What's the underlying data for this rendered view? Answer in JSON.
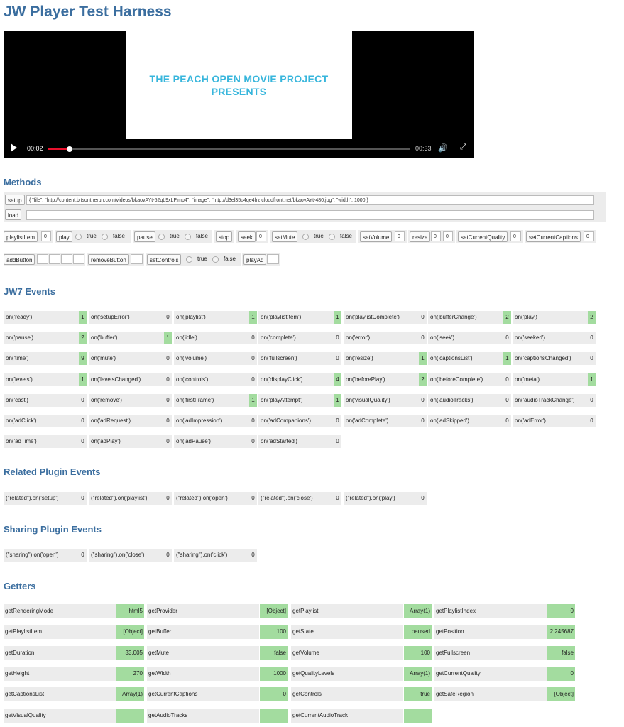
{
  "title": "JW Player Test Harness",
  "player": {
    "poster_line1": "THE PEACH OPEN MOVIE PROJECT",
    "poster_line2": "PRESENTS",
    "elapsed": "00:02",
    "duration": "00:33",
    "progress": 0.06
  },
  "sections": {
    "methods": "Methods",
    "jw7": "JW7 Events",
    "related": "Related Plugin Events",
    "sharing": "Sharing Plugin Events",
    "getters": "Getters"
  },
  "methods": {
    "setup_label": "setup",
    "setup_value": "{    \"file\": \"http://content.bitsontherun.com/videos/bkaovAYt-52qL9xLP.mp4\",    \"image\": \"http://d3el35u4qe4frz.cloudfront.net/bkaovAYt-480.jpg\", \"width\": 1000 }",
    "load_label": "load",
    "playlistItem": "playlistItem",
    "playlistItem_val": "0",
    "play": "play",
    "pause": "pause",
    "stop": "stop",
    "seek": "seek",
    "seek_val": "0",
    "setMute": "setMute",
    "setVolume": "setVolume",
    "setVolume_val": "0",
    "resize": "resize",
    "resize_w": "0",
    "resize_h": "0",
    "setCurrentQuality": "setCurrentQuality",
    "setCurrentQuality_val": "0",
    "setCurrentCaptions": "setCurrentCaptions",
    "setCurrentCaptions_val": "0",
    "addButton": "addButton",
    "removeButton": "removeButton",
    "setControls": "setControls",
    "playAd": "playAd",
    "true_label": "true",
    "false_label": "false"
  },
  "jw7_events": [
    {
      "label": "on('ready')",
      "count": "1",
      "on": true
    },
    {
      "label": "on('setupError')",
      "count": "0",
      "on": false
    },
    {
      "label": "on('playlist')",
      "count": "1",
      "on": true
    },
    {
      "label": "on('playlistItem')",
      "count": "1",
      "on": true
    },
    {
      "label": "on('playlistComplete')",
      "count": "0",
      "on": false
    },
    {
      "label": "on('bufferChange')",
      "count": "2",
      "on": true
    },
    {
      "label": "on('play')",
      "count": "2",
      "on": true
    },
    {
      "label": "on('pause')",
      "count": "2",
      "on": true
    },
    {
      "label": "on('buffer')",
      "count": "1",
      "on": true
    },
    {
      "label": "on('idle')",
      "count": "0",
      "on": false
    },
    {
      "label": "on('complete')",
      "count": "0",
      "on": false
    },
    {
      "label": "on('error')",
      "count": "0",
      "on": false
    },
    {
      "label": "on('seek')",
      "count": "0",
      "on": false
    },
    {
      "label": "on('seeked')",
      "count": "0",
      "on": false
    },
    {
      "label": "on('time')",
      "count": "9",
      "on": true
    },
    {
      "label": "on('mute')",
      "count": "0",
      "on": false
    },
    {
      "label": "on('volume')",
      "count": "0",
      "on": false
    },
    {
      "label": "on('fullscreen')",
      "count": "0",
      "on": false
    },
    {
      "label": "on('resize')",
      "count": "1",
      "on": true
    },
    {
      "label": "on('captionsList')",
      "count": "1",
      "on": true
    },
    {
      "label": "on('captionsChanged')",
      "count": "0",
      "on": false
    },
    {
      "label": "on('levels')",
      "count": "1",
      "on": true
    },
    {
      "label": "on('levelsChanged')",
      "count": "0",
      "on": false
    },
    {
      "label": "on('controls')",
      "count": "0",
      "on": false
    },
    {
      "label": "on('displayClick')",
      "count": "4",
      "on": true
    },
    {
      "label": "on('beforePlay')",
      "count": "2",
      "on": true
    },
    {
      "label": "on('beforeComplete')",
      "count": "0",
      "on": false
    },
    {
      "label": "on('meta')",
      "count": "1",
      "on": true
    },
    {
      "label": "on('cast')",
      "count": "0",
      "on": false
    },
    {
      "label": "on('remove')",
      "count": "0",
      "on": false
    },
    {
      "label": "on('firstFrame')",
      "count": "1",
      "on": true
    },
    {
      "label": "on('playAttempt')",
      "count": "1",
      "on": true
    },
    {
      "label": "on('visualQuality')",
      "count": "0",
      "on": false
    },
    {
      "label": "on('audioTracks')",
      "count": "0",
      "on": false
    },
    {
      "label": "on('audioTrackChange')",
      "count": "0",
      "on": false
    },
    {
      "label": "on('adClick')",
      "count": "0",
      "on": false
    },
    {
      "label": "on('adRequest')",
      "count": "0",
      "on": false
    },
    {
      "label": "on('adImpression')",
      "count": "0",
      "on": false
    },
    {
      "label": "on('adCompanions')",
      "count": "0",
      "on": false
    },
    {
      "label": "on('adComplete')",
      "count": "0",
      "on": false
    },
    {
      "label": "on('adSkipped')",
      "count": "0",
      "on": false
    },
    {
      "label": "on('adError')",
      "count": "0",
      "on": false
    },
    {
      "label": "on('adTime')",
      "count": "0",
      "on": false
    },
    {
      "label": "on('adPlay')",
      "count": "0",
      "on": false
    },
    {
      "label": "on('adPause')",
      "count": "0",
      "on": false
    },
    {
      "label": "on('adStarted')",
      "count": "0",
      "on": false
    }
  ],
  "related_events": [
    {
      "label": "(\"related\").on('setup')",
      "count": "0"
    },
    {
      "label": "(\"related\").on('playlist')",
      "count": "0"
    },
    {
      "label": "(\"related\").on('open')",
      "count": "0"
    },
    {
      "label": "(\"related\").on('close')",
      "count": "0"
    },
    {
      "label": "(\"related\").on('play')",
      "count": "0"
    }
  ],
  "sharing_events": [
    {
      "label": "(\"sharing\").on('open')",
      "count": "0"
    },
    {
      "label": "(\"sharing\").on('close')",
      "count": "0"
    },
    {
      "label": "(\"sharing\").on('click')",
      "count": "0"
    }
  ],
  "getters": [
    {
      "label": "getRenderingMode",
      "value": "html5"
    },
    {
      "label": "getProvider",
      "value": "[Object]"
    },
    {
      "label": "getPlaylist",
      "value": "Array(1)"
    },
    {
      "label": "getPlaylistIndex",
      "value": "0"
    },
    {
      "label": "getPlaylistItem",
      "value": "[Object]"
    },
    {
      "label": "getBuffer",
      "value": "100"
    },
    {
      "label": "getState",
      "value": "paused"
    },
    {
      "label": "getPosition",
      "value": "2.245687"
    },
    {
      "label": "getDuration",
      "value": "33.005"
    },
    {
      "label": "getMute",
      "value": "false"
    },
    {
      "label": "getVolume",
      "value": "100"
    },
    {
      "label": "getFullscreen",
      "value": "false"
    },
    {
      "label": "getHeight",
      "value": "270"
    },
    {
      "label": "getWidth",
      "value": "1000"
    },
    {
      "label": "getQualityLevels",
      "value": "Array(1)"
    },
    {
      "label": "getCurrentQuality",
      "value": "0"
    },
    {
      "label": "getCaptionsList",
      "value": "Array(1)"
    },
    {
      "label": "getCurrentCaptions",
      "value": "0"
    },
    {
      "label": "getControls",
      "value": "true"
    },
    {
      "label": "getSafeRegion",
      "value": "[Object]"
    },
    {
      "label": "getVisualQuality",
      "value": ""
    },
    {
      "label": "getAudioTracks",
      "value": ""
    },
    {
      "label": "getCurrentAudioTrack",
      "value": ""
    }
  ]
}
